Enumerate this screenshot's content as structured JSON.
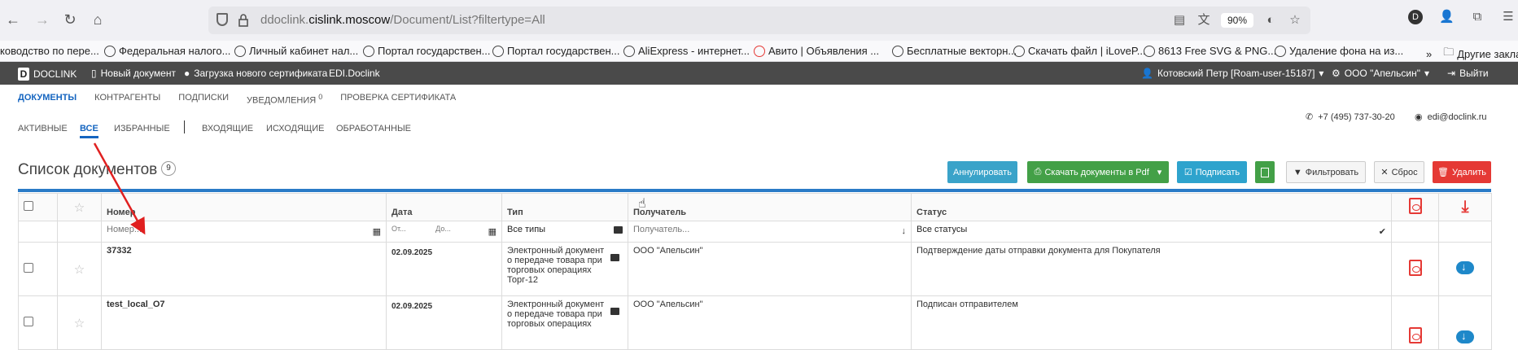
{
  "browser": {
    "url_domain": "ddoclink.",
    "url_host": "cislink.moscow",
    "url_path": "/Document/List?filtertype=All",
    "zoom": "90%",
    "profile_initial": "D",
    "bookmarks": [
      "ководство по пере...",
      "Федеральная налого...",
      "Личный кабинет нал...",
      "Портал государствен...",
      "Портал государствен...",
      "AliExpress - интернет...",
      "Авито | Объявления ...",
      "Бесплатные векторн...",
      "Скачать файл | iLoveP...",
      "8613 Free SVG & PNG...",
      "Удаление фона на из...",
      "Другие закладки"
    ]
  },
  "header": {
    "logo_letter": "D",
    "logo_text": "DOCLINK",
    "new_doc": "Новый документ",
    "upload_cert": "Загрузка нового сертификата",
    "edi": "EDI.Doclink",
    "user": "Котовский Петр [Roam-user-15187]",
    "org": "ООО \"Апельсин\"",
    "logout": "Выйти"
  },
  "mainnav": {
    "documents": "ДОКУМЕНТЫ",
    "counterparties": "КОНТРАГЕНТЫ",
    "signatures": "ПОДПИСКИ",
    "notifications": "УВЕДОМЛЕНИЯ",
    "notifications_count": "0",
    "check_cert": "ПРОВЕРКА СЕРТИФИКАТА"
  },
  "subnav": {
    "active": "АКТИВНЫЕ",
    "all": "ВСЕ",
    "favorites": "ИЗБРАННЫЕ",
    "incoming": "ВХОДЯЩИЕ",
    "outgoing": "ИСХОДЯЩИЕ",
    "processed": "ОБРАБОТАННЫЕ"
  },
  "contacts": {
    "phone": "+7 (495) 737-30-20",
    "email": "edi@doclink.ru"
  },
  "page": {
    "title": "Список документов",
    "count": "9"
  },
  "actions": {
    "annul": "Аннулировать",
    "download_pdf": "Скачать документы в Pdf",
    "sign": "Подписать",
    "filter": "Фильтровать",
    "reset": "Сброс",
    "delete": "Удалить"
  },
  "colors": {
    "annul": "#3aa3c9",
    "download": "#43a047",
    "sign": "#2ea3cd",
    "delete": "#e53935",
    "accent": "#2a7bc7"
  },
  "table": {
    "columns": {
      "number": "Номер",
      "date": "Дата",
      "type": "Тип",
      "recipient": "Получатель",
      "status": "Статус"
    },
    "filters": {
      "number_placeholder": "Номер...",
      "date_from": "От...",
      "date_to": "До...",
      "type_value": "Все типы",
      "recipient_placeholder": "Получатель...",
      "status_value": "Все статусы"
    },
    "rows": [
      {
        "number": "37332",
        "date": "02.09.2025",
        "type": "Электронный документ о передаче товара при торговых операциях Торг-12",
        "recipient": "ООО \"Апельсин\"",
        "status": "Подтверждение даты отправки документа для Покупателя"
      },
      {
        "number": "test_local_O7",
        "date": "02.09.2025",
        "type": "Электронный документ о передаче товара при торговых операциях",
        "recipient": "ООО \"Апельсин\"",
        "status": "Подписан отправителем"
      }
    ]
  }
}
